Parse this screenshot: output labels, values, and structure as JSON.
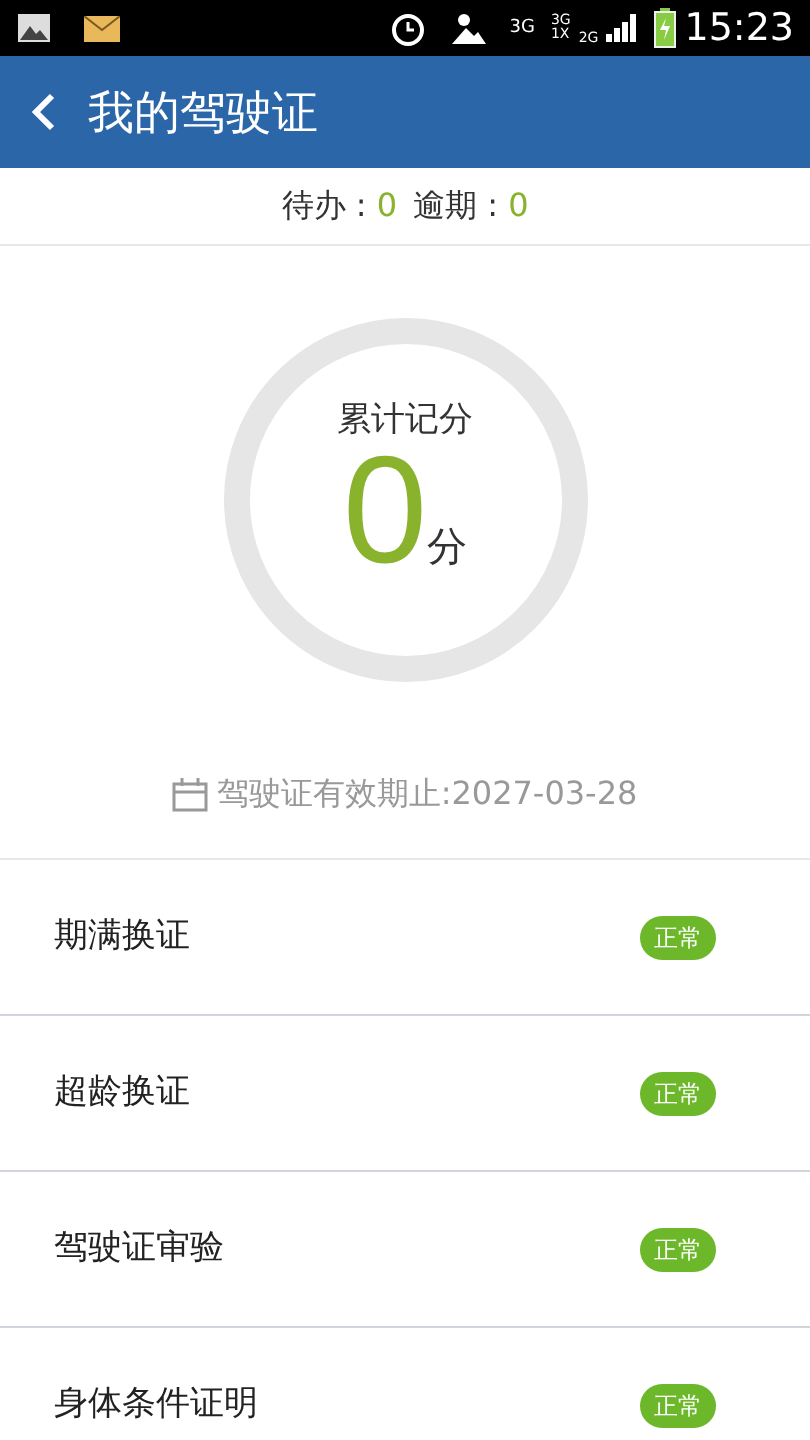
{
  "status_bar": {
    "time": "15:23",
    "network_labels": [
      "3G",
      "3G",
      "1X",
      "2G"
    ]
  },
  "header": {
    "title": "我的驾驶证"
  },
  "summary": {
    "items": [
      {
        "label": "待办 : ",
        "value": "0"
      },
      {
        "label": "逾期 : ",
        "value": "0"
      }
    ]
  },
  "score": {
    "label": "累计记分",
    "value": "0",
    "unit": "分"
  },
  "validity": {
    "text": "驾驶证有效期止:2027-03-28"
  },
  "items": [
    {
      "label": "期满换证",
      "status": "正常"
    },
    {
      "label": "超龄换证",
      "status": "正常"
    },
    {
      "label": "驾驶证审验",
      "status": "正常"
    },
    {
      "label": "身体条件证明",
      "status": "正常"
    }
  ]
}
